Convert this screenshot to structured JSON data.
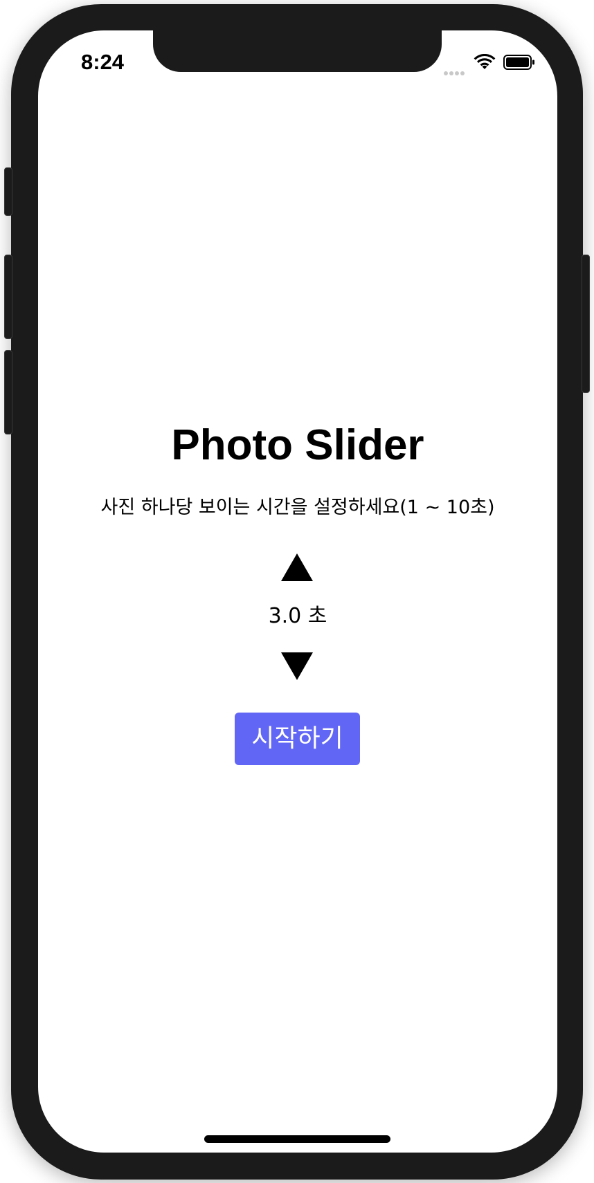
{
  "status_bar": {
    "time": "8:24",
    "signal_icon": "signal-dots-icon",
    "wifi_icon": "wifi-icon",
    "battery_icon": "battery-full-icon"
  },
  "main": {
    "title": "Photo Slider",
    "subtitle": "사진 하나당 보이는 시간을 설정하세요(1 ~ 10초)",
    "increase_icon": "triangle-up-icon",
    "duration_value": "3.0 초",
    "decrease_icon": "triangle-down-icon",
    "start_button_label": "시작하기"
  },
  "colors": {
    "background": "#ffffff",
    "device_frame": "#1c1b1c",
    "button_background": "#6266f5",
    "button_text": "#ffffff",
    "text": "#000000"
  }
}
